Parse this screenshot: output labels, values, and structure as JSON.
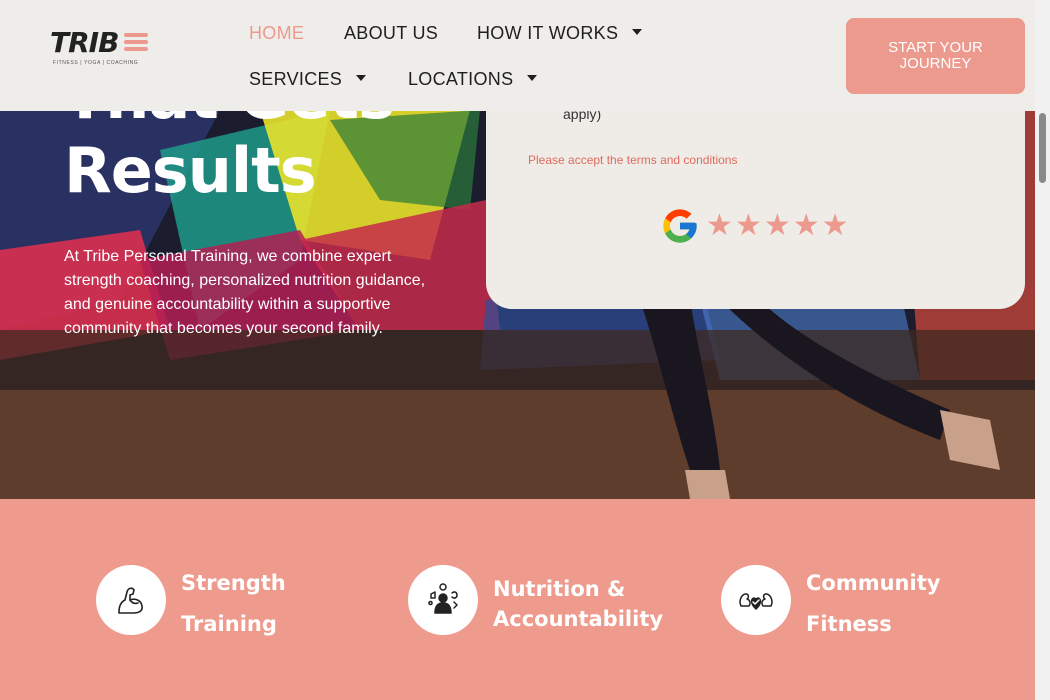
{
  "header": {
    "logo_text": "TRIB",
    "logo_tagline": "FITNESS | YOGA | COACHING",
    "nav": {
      "home": "HOME",
      "about": "ABOUT US",
      "how": "HOW IT WORKS",
      "services": "SERVICES",
      "locations": "LOCATIONS"
    },
    "cta": "START YOUR JOURNEY"
  },
  "hero": {
    "title_line1": "That Gets",
    "title_line2": "Results",
    "description": "At Tribe Personal Training, we combine expert strength coaching, personalized nutrition guidance, and genuine accountability within a supportive community that becomes your second family."
  },
  "form": {
    "terms_tail": "apply)",
    "terms_error": "Please accept the terms and conditions",
    "rating_stars": 5
  },
  "features": [
    {
      "label": "Strength Training",
      "icon": "flexed-arm-icon"
    },
    {
      "label": "Nutrition & Accountability",
      "icon": "nutrition-person-icon"
    },
    {
      "label": "Community Fitness",
      "icon": "heart-arms-icon"
    }
  ],
  "colors": {
    "accent": "#ec9a8e",
    "header_bg": "#efede9",
    "features_bg": "#ee9a8c"
  }
}
